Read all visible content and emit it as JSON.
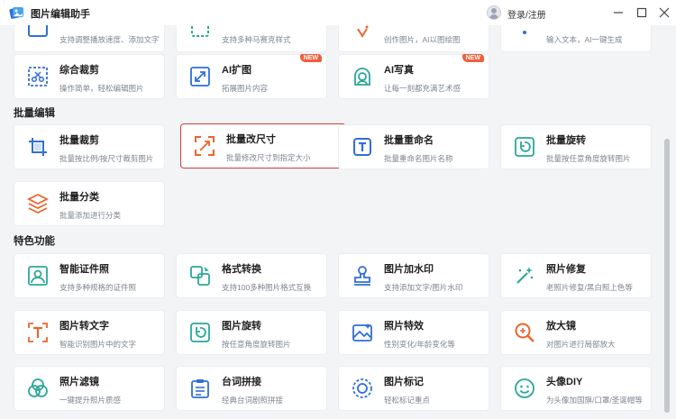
{
  "titlebar": {
    "app_title": "图片编辑助手",
    "login_label": "登录/注册"
  },
  "partial_row": [
    {
      "desc": "支持调整播放速度、添加文字",
      "icon": "speed-icon"
    },
    {
      "desc": "支持多种马赛克样式",
      "icon": "mosaic-icon"
    },
    {
      "desc": "创作图片，AI以图绘图",
      "icon": "ai-draw-icon"
    },
    {
      "desc": "输入文本，AI一键生成",
      "icon": "text-to-image-icon"
    }
  ],
  "top_row": [
    {
      "title": "综合裁剪",
      "desc": "操作简单，轻松编辑图片",
      "icon": "crop-icon"
    },
    {
      "title": "AI扩图",
      "desc": "拓展图片内容",
      "icon": "expand-icon",
      "badge": "NEW"
    },
    {
      "title": "AI写真",
      "desc": "让每一刻都充满艺术感",
      "icon": "portrait-icon",
      "badge": "NEW"
    }
  ],
  "batch": {
    "section_title": "批量编辑",
    "items": [
      {
        "title": "批量裁剪",
        "desc": "批量按比例/按尺寸裁剪图片",
        "icon": "batch-crop-icon"
      },
      {
        "title": "批量改尺寸",
        "desc": "批量修改尺寸到指定大小",
        "icon": "resize-icon"
      },
      {
        "title": "批量重命名",
        "desc": "批量重命名图片名称",
        "icon": "rename-icon"
      },
      {
        "title": "批量旋转",
        "desc": "批量按任意角度旋转图片",
        "icon": "rotate-icon"
      },
      {
        "title": "批量分类",
        "desc": "批量添加进行分类",
        "icon": "layers-icon"
      }
    ]
  },
  "features": {
    "section_title": "特色功能",
    "items": [
      {
        "title": "智能证件照",
        "desc": "支持多种规格的证件照",
        "icon": "id-photo-icon"
      },
      {
        "title": "格式转换",
        "desc": "支持100多种图片格式互换",
        "icon": "convert-icon"
      },
      {
        "title": "图片加水印",
        "desc": "支持添加文字/图片水印",
        "icon": "stamp-icon"
      },
      {
        "title": "照片修复",
        "desc": "老照片修复/黑白照上色等",
        "icon": "magic-wand-icon"
      },
      {
        "title": "图片转文字",
        "desc": "智能识别图片中的文字",
        "icon": "ocr-icon"
      },
      {
        "title": "图片旋转",
        "desc": "按任意角度旋转图片",
        "icon": "image-rotate-icon"
      },
      {
        "title": "照片特效",
        "desc": "性别变化/年龄变化等",
        "icon": "photo-effect-icon"
      },
      {
        "title": "放大镜",
        "desc": "对图片进行局部放大",
        "icon": "magnifier-icon"
      },
      {
        "title": "照片滤镜",
        "desc": "一键提升照片质感",
        "icon": "filter-icon"
      },
      {
        "title": "台词拼接",
        "desc": "经典台词剧照拼接",
        "icon": "clipboard-icon"
      },
      {
        "title": "图片标记",
        "desc": "轻松标记重点",
        "icon": "target-icon"
      },
      {
        "title": "头像DIY",
        "desc": "为头像加国旗/口罩/圣诞帽等",
        "icon": "smiley-icon"
      }
    ]
  },
  "colors": {
    "accent_blue": "#2f6fd8",
    "accent_teal": "#2aa89a",
    "accent_orange": "#e8662e",
    "selected_border": "#d23d3d",
    "badge": "#f0603a"
  }
}
